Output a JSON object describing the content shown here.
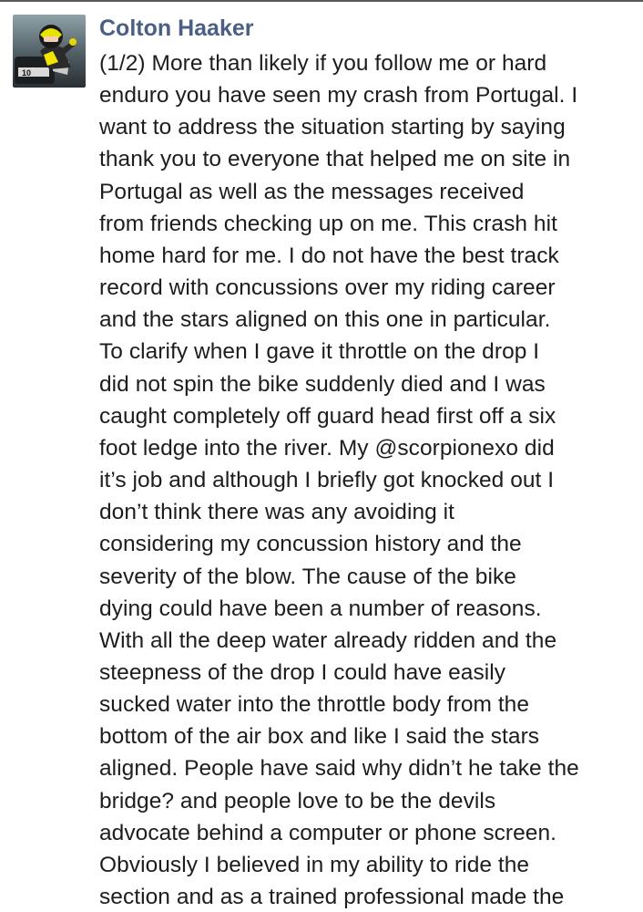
{
  "post": {
    "author": "Colton Haaker",
    "avatar_icon": "rider-avatar-photo",
    "lines": [
      "(1/2) More than likely if you follow me or hard",
      "enduro you have seen my crash from Portugal. I",
      "want to address the situation starting by saying",
      "thank you to everyone that helped me on site in",
      "Portugal as well as the messages received",
      "from friends checking up on me. This crash hit",
      "home hard for me. I do not have the best track",
      "record with concussions over my riding career",
      "and the stars aligned on this one in particular.",
      "To clarify when I gave it throttle on the drop I",
      "did not spin the bike suddenly died and I was",
      "caught completely off guard head first off a six",
      "foot ledge into the river. My @scorpionexo did",
      "it’s job and although I briefly got knocked out I",
      "don’t think there was any avoiding it",
      "considering my concussion history and the",
      "severity of the blow. The cause of the bike",
      "dying could have been a number of reasons.",
      "With all the deep water already ridden and the",
      "steepness of the drop I could have easily",
      "sucked water into the throttle body from the",
      "bottom of the air box and like I said the stars",
      "aligned. People have said why didn’t he take the",
      "bridge? and people love to be the devils",
      "advocate behind a computer or phone screen.",
      "Obviously I believed in my ability to ride the",
      "section and as a trained professional made the"
    ]
  },
  "colors": {
    "author_name": "#4b5f86",
    "body_text": "#1d1d1d",
    "background": "#ffffff"
  }
}
